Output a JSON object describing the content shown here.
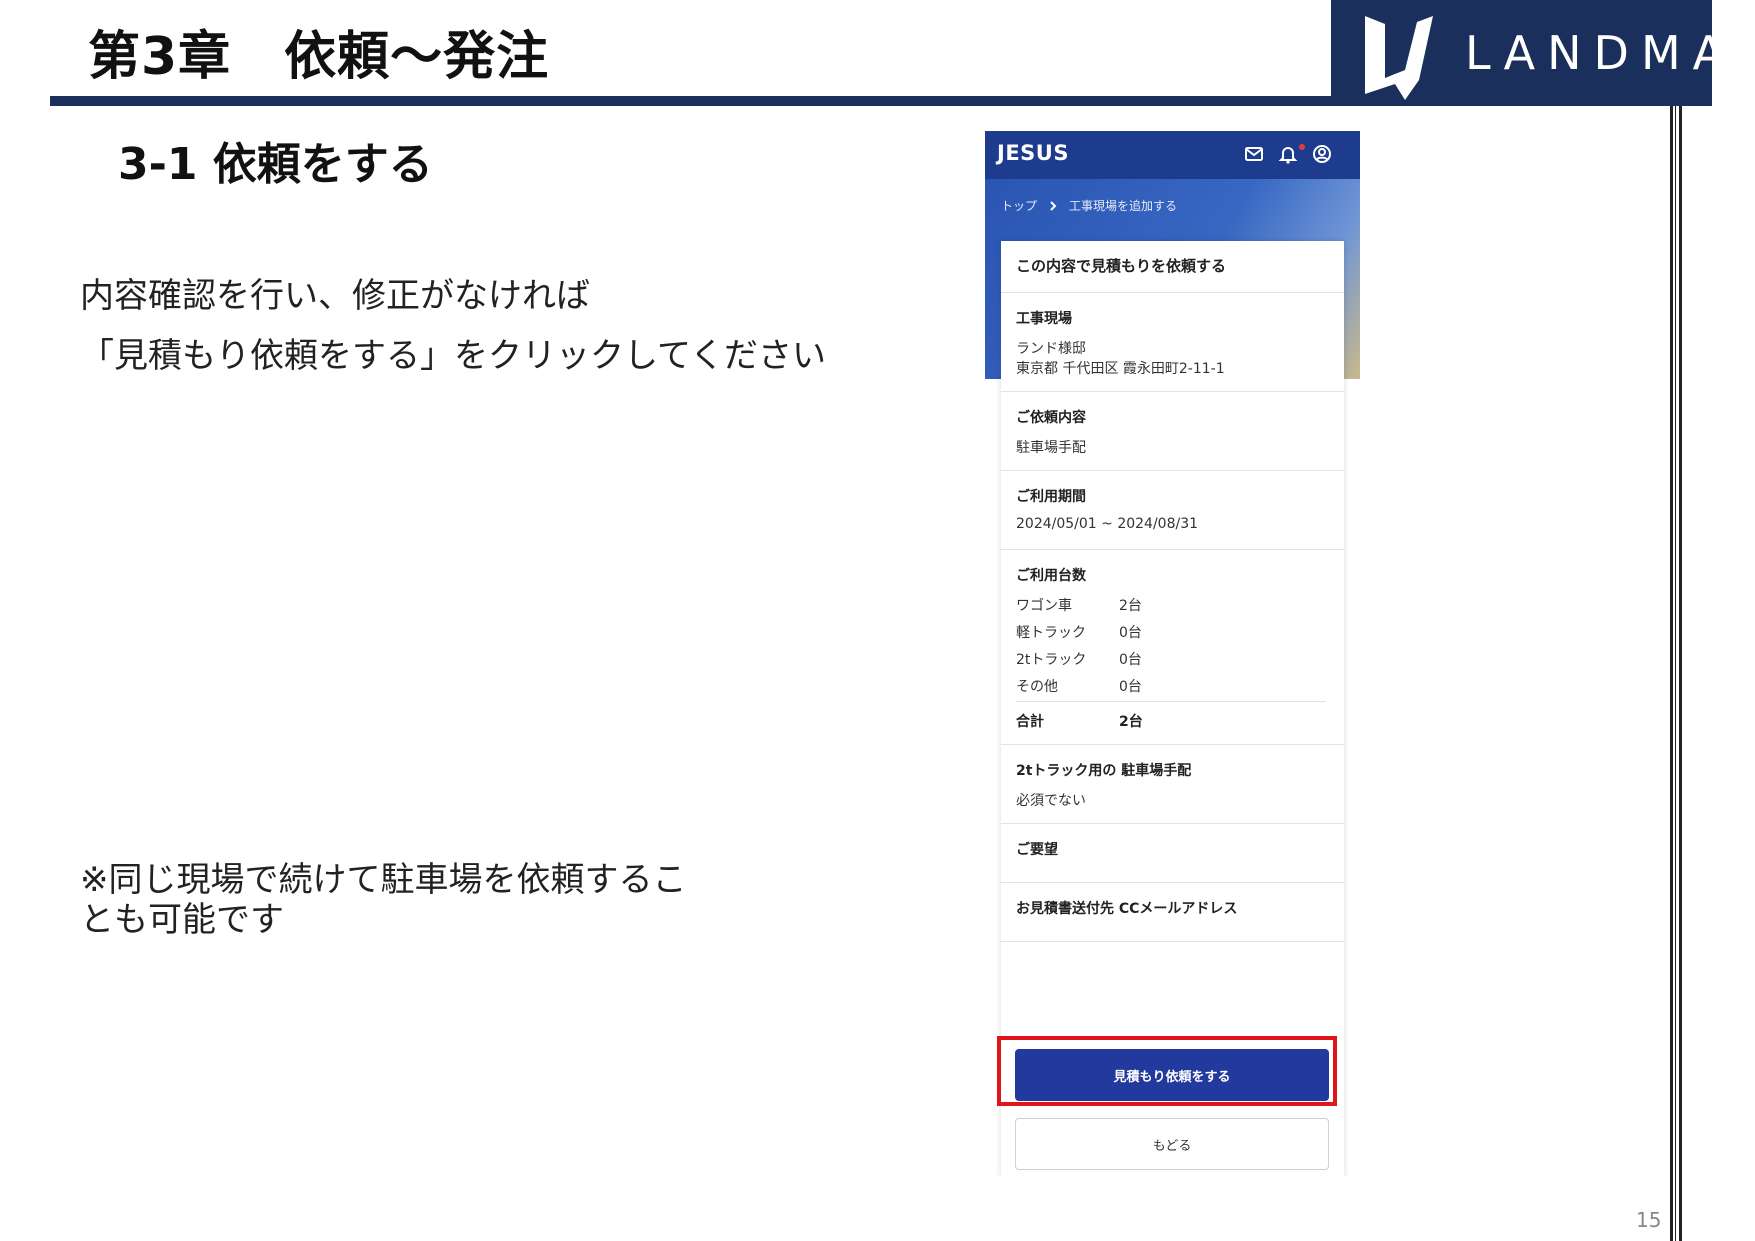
{
  "slide": {
    "chapter_title": "第3章　依頼～発注",
    "section_title": "3-1 依頼をする",
    "instruction_line1": "内容確認を行い、修正がなければ",
    "instruction_line2": "「見積もり依頼をする」をクリックしてください",
    "note": "※同じ現場で続けて駐車場を依頼することも可能です",
    "page_number": "15",
    "brand_name": "LANDMARK",
    "colors": {
      "header_navy": "#1b2f5c",
      "highlight_red": "#e0141b"
    }
  },
  "app": {
    "logo": "JESUS",
    "icons": [
      "mail-icon",
      "bell-icon",
      "account-icon"
    ],
    "breadcrumb": {
      "home": "トップ",
      "current": "工事現場を追加する"
    },
    "card_title": "この内容で見積もりを依頼する",
    "site": {
      "label": "工事現場",
      "name": "ランド様邸",
      "address": "東京都 千代田区 霞永田町2-11-1"
    },
    "request": {
      "label": "ご依頼内容",
      "value": "駐車場手配"
    },
    "period": {
      "label": "ご利用期間",
      "value": "2024/05/01 ~ 2024/08/31"
    },
    "vehicles": {
      "label": "ご利用台数",
      "rows": [
        {
          "name": "ワゴン車",
          "count": "2台"
        },
        {
          "name": "軽トラック",
          "count": "0台"
        },
        {
          "name": "2tトラック",
          "count": "0台"
        },
        {
          "name": "その他",
          "count": "0台"
        }
      ],
      "total_label": "合計",
      "total_value": "2台"
    },
    "truck_parking": {
      "label": "2tトラック用の 駐車場手配",
      "value": "必須でない"
    },
    "requests_label": "ご要望",
    "cc_label": "お見積書送付先 CCメールアドレス",
    "submit_label": "見積もり依頼をする",
    "back_label": "もどる",
    "colors": {
      "app_bar": "#1d3c8d",
      "primary_button": "#22399d"
    }
  }
}
